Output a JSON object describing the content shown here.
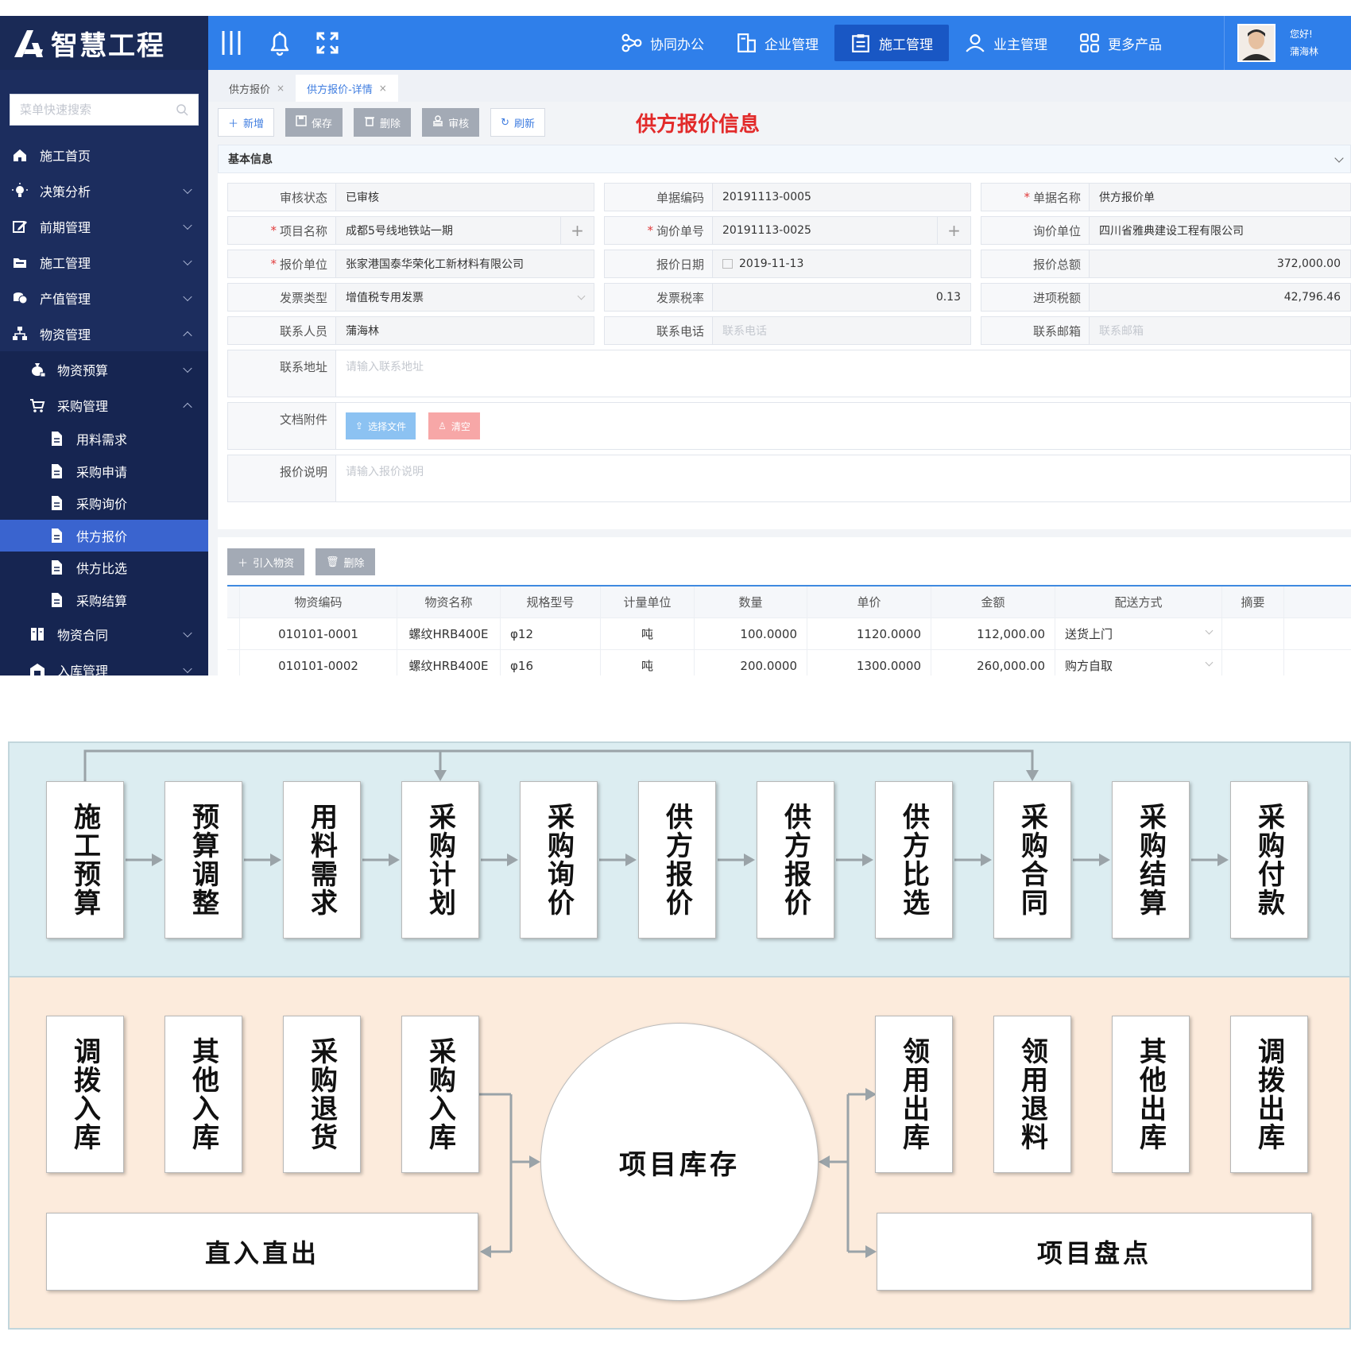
{
  "app": {
    "logo_text": "智慧工程",
    "search_placeholder": "菜单快速搜索",
    "menu": [
      {
        "label": "施工首页",
        "icon": "home-icon",
        "level": 1,
        "chevron": "none"
      },
      {
        "label": "决策分析",
        "icon": "bulb-icon",
        "level": 1,
        "chevron": "down"
      },
      {
        "label": "前期管理",
        "icon": "edit-icon",
        "level": 1,
        "chevron": "down"
      },
      {
        "label": "施工管理",
        "icon": "folder-icon",
        "level": 1,
        "chevron": "down"
      },
      {
        "label": "产值管理",
        "icon": "coins-icon",
        "level": 1,
        "chevron": "down"
      },
      {
        "label": "物资管理",
        "icon": "sitemap-icon",
        "level": 1,
        "chevron": "up"
      },
      {
        "label": "物资预算",
        "icon": "moneybag-icon",
        "level": 2,
        "chevron": "down"
      },
      {
        "label": "采购管理",
        "icon": "cart-icon",
        "level": 2,
        "chevron": "up"
      },
      {
        "label": "用料需求",
        "icon": "doc-icon",
        "level": 3,
        "chevron": "none"
      },
      {
        "label": "采购申请",
        "icon": "doc-icon",
        "level": 3,
        "chevron": "none"
      },
      {
        "label": "采购询价",
        "icon": "doc-icon",
        "level": 3,
        "chevron": "none"
      },
      {
        "label": "供方报价",
        "icon": "doc-icon",
        "level": 3,
        "chevron": "none",
        "active": true
      },
      {
        "label": "供方比选",
        "icon": "doc-icon",
        "level": 3,
        "chevron": "none"
      },
      {
        "label": "采购结算",
        "icon": "doc-icon",
        "level": 3,
        "chevron": "none"
      },
      {
        "label": "物资合同",
        "icon": "contract-icon",
        "level": 2,
        "chevron": "down"
      },
      {
        "label": "入库管理",
        "icon": "warehouse-icon",
        "level": 2,
        "chevron": "down"
      }
    ],
    "nav": [
      {
        "label": "协同办公",
        "icon": "share-icon"
      },
      {
        "label": "企业管理",
        "icon": "building-icon"
      },
      {
        "label": "施工管理",
        "icon": "clipboard-icon",
        "active": true
      },
      {
        "label": "业主管理",
        "icon": "user-icon"
      },
      {
        "label": "更多产品",
        "icon": "grid-icon"
      }
    ],
    "user": {
      "greeting": "您好!",
      "name": "蒲海林"
    },
    "tabs": [
      {
        "label": "供方报价",
        "close": "×"
      },
      {
        "label": "供方报价-详情",
        "close": "×",
        "active": true
      }
    ],
    "toolbar": {
      "add": "新增",
      "save": "保存",
      "delete": "删除",
      "audit": "审核",
      "refresh": "刷新"
    },
    "page_title": "供方报价信息",
    "section_title": "基本信息",
    "fields": {
      "audit_status": {
        "label": "审核状态",
        "value": "已审核"
      },
      "doc_code": {
        "label": "单据编码",
        "value": "20191113-0005"
      },
      "doc_name": {
        "label": "单据名称",
        "value": "供方报价单"
      },
      "project_name": {
        "label": "项目名称",
        "value": "成都5号线地铁站一期"
      },
      "inquiry_no": {
        "label": "询价单号",
        "value": "20191113-0025"
      },
      "inquiry_unit": {
        "label": "询价单位",
        "value": "四川省雅典建设工程有限公司"
      },
      "quote_unit": {
        "label": "报价单位",
        "value": "张家港国泰华荣化工新材料有限公司"
      },
      "quote_date": {
        "label": "报价日期",
        "value": "2019-11-13"
      },
      "quote_total": {
        "label": "报价总额",
        "value": "372,000.00"
      },
      "invoice_type": {
        "label": "发票类型",
        "value": "增值税专用发票"
      },
      "tax_rate": {
        "label": "发票税率",
        "value": "0.13"
      },
      "input_tax": {
        "label": "进项税额",
        "value": "42,796.46"
      },
      "contact": {
        "label": "联系人员",
        "value": "蒲海林"
      },
      "phone": {
        "label": "联系电话",
        "placeholder": "联系电话"
      },
      "email": {
        "label": "联系邮箱",
        "placeholder": "联系邮箱"
      },
      "address": {
        "label": "联系地址",
        "placeholder": "请输入联系地址"
      },
      "attachment": {
        "label": "文档附件",
        "choose": "选择文件",
        "clear": "清空"
      },
      "remark": {
        "label": "报价说明",
        "placeholder": "请输入报价说明"
      }
    },
    "grid_tools": {
      "import": "引入物资",
      "delete": "删除"
    },
    "grid": {
      "columns": [
        "物资编码",
        "物资名称",
        "规格型号",
        "计量单位",
        "数量",
        "单价",
        "金额",
        "配送方式",
        "摘要"
      ],
      "rows": [
        [
          "010101-0001",
          "螺纹HRB400E",
          "φ12",
          "吨",
          "100.0000",
          "1120.0000",
          "112,000.00",
          "送货上门",
          ""
        ],
        [
          "010101-0002",
          "螺纹HRB400E",
          "φ16",
          "吨",
          "200.0000",
          "1300.0000",
          "260,000.00",
          "购方自取",
          ""
        ]
      ]
    },
    "colors": {
      "sidebar": "#1c2d5e",
      "topbar": "#2f7fea",
      "active": "#3a64cf",
      "title_red": "#e22a2a",
      "upload_blue": "#8cc2f2",
      "clear_red": "#f7a7a7"
    }
  },
  "diagram": {
    "top_row": [
      "施工预算",
      "预算调整",
      "用料需求",
      "采购计划",
      "采购询价",
      "供方报价",
      "供方报价",
      "供方比选",
      "采购合同",
      "采购结算",
      "采购付款"
    ],
    "bottom_left": [
      "调拨入库",
      "其他入库",
      "采购退货",
      "采购入库"
    ],
    "bottom_right": [
      "领用出库",
      "领用退料",
      "其他出库",
      "调拨出库"
    ],
    "center": "项目库存",
    "direct": "直入直出",
    "inventory_check": "项目盘点"
  }
}
